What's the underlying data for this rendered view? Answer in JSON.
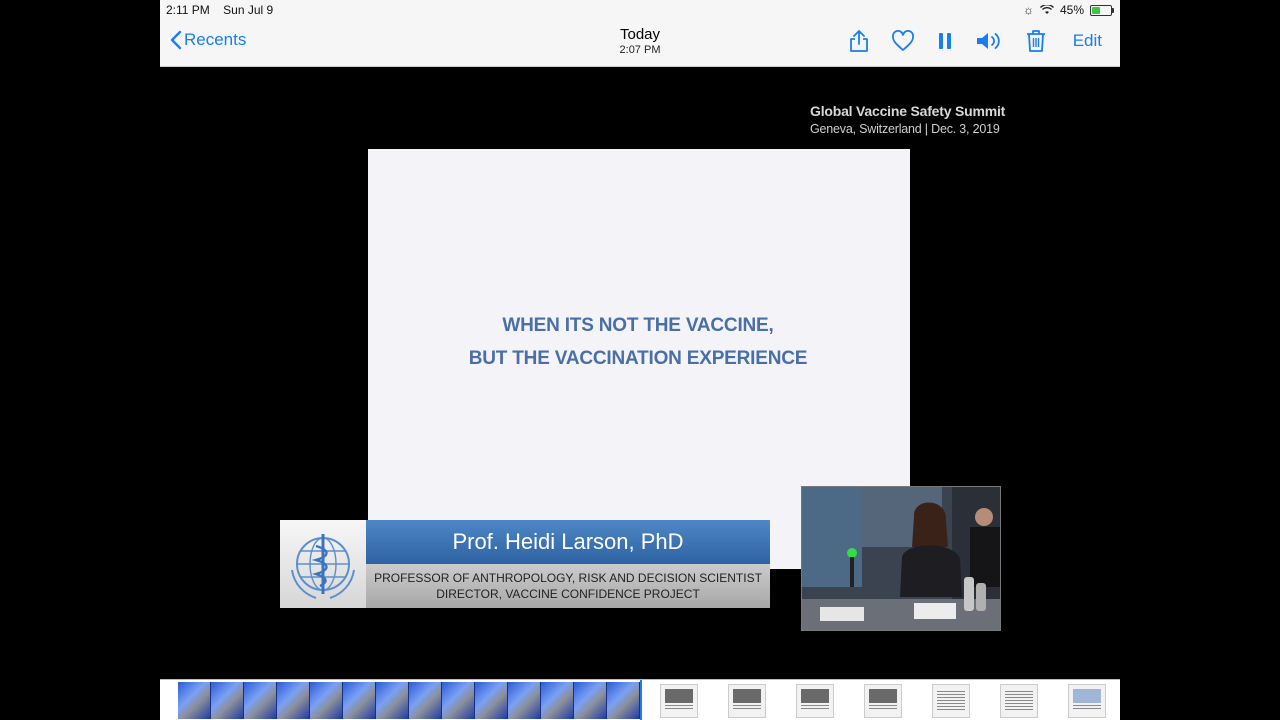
{
  "status_bar": {
    "time": "2:11 PM",
    "date": "Sun Jul 9",
    "battery": "45%",
    "battery_level": 0.45
  },
  "nav": {
    "back_label": "Recents",
    "title": "Today",
    "subtitle": "2:07 PM",
    "edit_label": "Edit",
    "icons": [
      "share-icon",
      "heart-icon",
      "pause-icon",
      "speaker-icon",
      "trash-icon"
    ]
  },
  "video": {
    "event_title": "Global Vaccine Safety Summit",
    "event_location": "Geneva, Switzerland  |  Dec. 3, 2019",
    "slide_line1": "WHEN ITS NOT THE VACCINE,",
    "slide_line2": "BUT THE VACCINATION EXPERIENCE",
    "speaker_name": "Prof. Heidi Larson, PhD",
    "speaker_title1": "PROFESSOR OF ANTHROPOLOGY, RISK AND DECISION SCIENTIST",
    "speaker_title2": "DIRECTOR, VACCINE CONFIDENCE PROJECT"
  },
  "colors": {
    "accent": "#1a7ef0",
    "name_bar": "#3a6fb4",
    "slide_text": "#4a6fa8"
  }
}
